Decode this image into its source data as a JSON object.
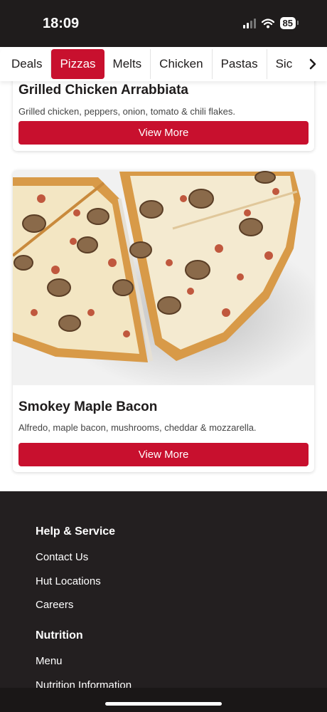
{
  "status_bar": {
    "time": "18:09",
    "battery": "85",
    "icons": [
      "signal-icon",
      "wifi-icon",
      "battery-icon"
    ]
  },
  "tabs": {
    "items": [
      "Deals",
      "Pizzas",
      "Melts",
      "Chicken",
      "Pastas",
      "Sic"
    ],
    "active": "Pizzas",
    "next_icon": "chevron-right-icon"
  },
  "products": [
    {
      "title": "Grilled Chicken Arrabbiata",
      "description": "Grilled chicken, peppers, onion, tomato & chili flakes.",
      "button": "View More"
    },
    {
      "title": "Smokey Maple Bacon",
      "description": "Alfredo, maple bacon, mushrooms, cheddar & mozzarella.",
      "button": "View More",
      "image": "pizza-photo"
    }
  ],
  "footer": {
    "help_heading": "Help & Service",
    "help_links": [
      "Contact Us",
      "Hut Locations",
      "Careers"
    ],
    "nutrition_heading": "Nutrition",
    "nutrition_links": [
      "Menu",
      "Nutrition Information"
    ]
  },
  "colors": {
    "brand_red": "#c8102e",
    "footer_bg": "#231f20",
    "status_bg": "#1f1c1c"
  }
}
